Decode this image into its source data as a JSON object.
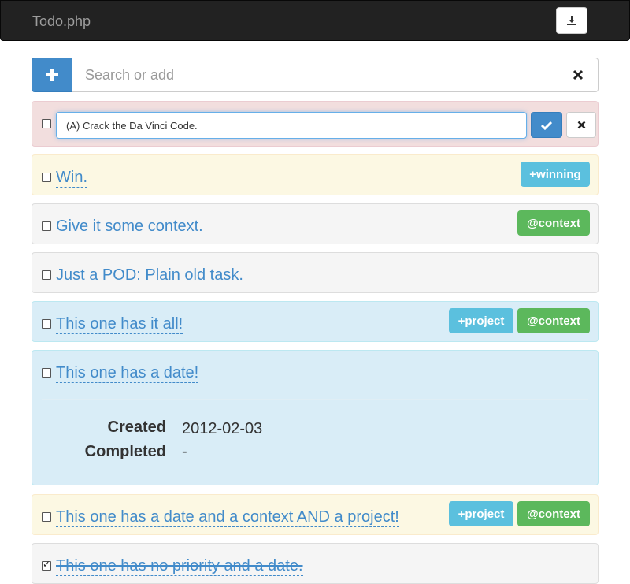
{
  "app": {
    "title": "Todo.php",
    "download_icon": "download-icon"
  },
  "search": {
    "placeholder": "Search or add",
    "add_icon": "plus-icon",
    "clear_icon": "close-icon"
  },
  "editing": {
    "value": "(A) Crack the Da Vinci Code."
  },
  "colors": {
    "danger": "#f2dede",
    "warning": "#fcf8e3",
    "default": "#f5f5f5",
    "info": "#d9edf7",
    "primary": "#428bca",
    "project_tag": "#5bc0de",
    "context_tag": "#5cb85c"
  },
  "tasks": [
    {
      "text": "Win.",
      "tags": [
        "+winning"
      ],
      "checked": false
    },
    {
      "text": "Give it some context.",
      "tags": [
        "@context"
      ],
      "checked": false
    },
    {
      "text": "Just a POD: Plain old task.",
      "tags": [],
      "checked": false
    },
    {
      "text": "This one has it all!",
      "tags": [
        "+project",
        "@context"
      ],
      "checked": false
    },
    {
      "text": "This one has a date!",
      "tags": [],
      "checked": false,
      "details": {
        "created_label": "Created",
        "created": "2012-02-03",
        "completed_label": "Completed",
        "completed": "-"
      }
    },
    {
      "text": "This one has a date and a context AND a project!",
      "tags": [
        "+project",
        "@context"
      ],
      "checked": false
    },
    {
      "text": "This one has no priority and a date.",
      "tags": [],
      "checked": true
    }
  ]
}
